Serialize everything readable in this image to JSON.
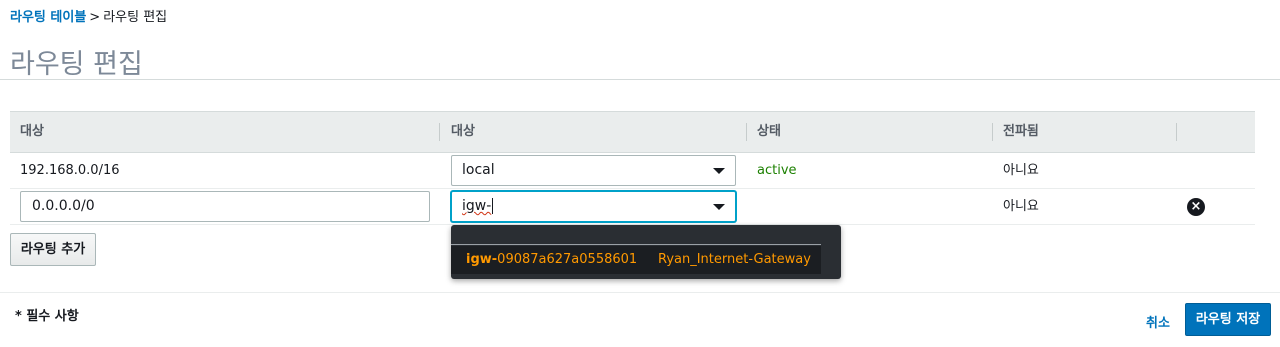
{
  "breadcrumb": {
    "parent": "라우팅 테이블",
    "separator": ">",
    "current": "라우팅 편집"
  },
  "page": {
    "title": "라우팅 편집"
  },
  "table": {
    "headers": [
      "대상",
      "대상",
      "상태",
      "전파됨"
    ],
    "rows": [
      {
        "destination": "192.168.0.0/16",
        "target": "local",
        "status": "active",
        "propagated": "아니요"
      },
      {
        "destination": "0.0.0.0/0",
        "target_typed": "igw-",
        "status": "",
        "propagated": "아니요"
      }
    ]
  },
  "add_route_button": "라우팅 추가",
  "dropdown": {
    "options": [
      {
        "id_prefix": "igw-",
        "id_rest": "09087a627a0558601",
        "name": "Ryan_Internet-Gateway"
      }
    ]
  },
  "footer": {
    "required_note": "* 필수 사항",
    "cancel": "취소",
    "save": "라우팅 저장"
  },
  "colors": {
    "link": "#0073bb",
    "active": "#1d8102",
    "dropdown_text": "#ff9900",
    "primary_button": "#0073bb"
  },
  "icons": {
    "remove": "remove-circle-icon",
    "caret": "caret-down-icon"
  }
}
